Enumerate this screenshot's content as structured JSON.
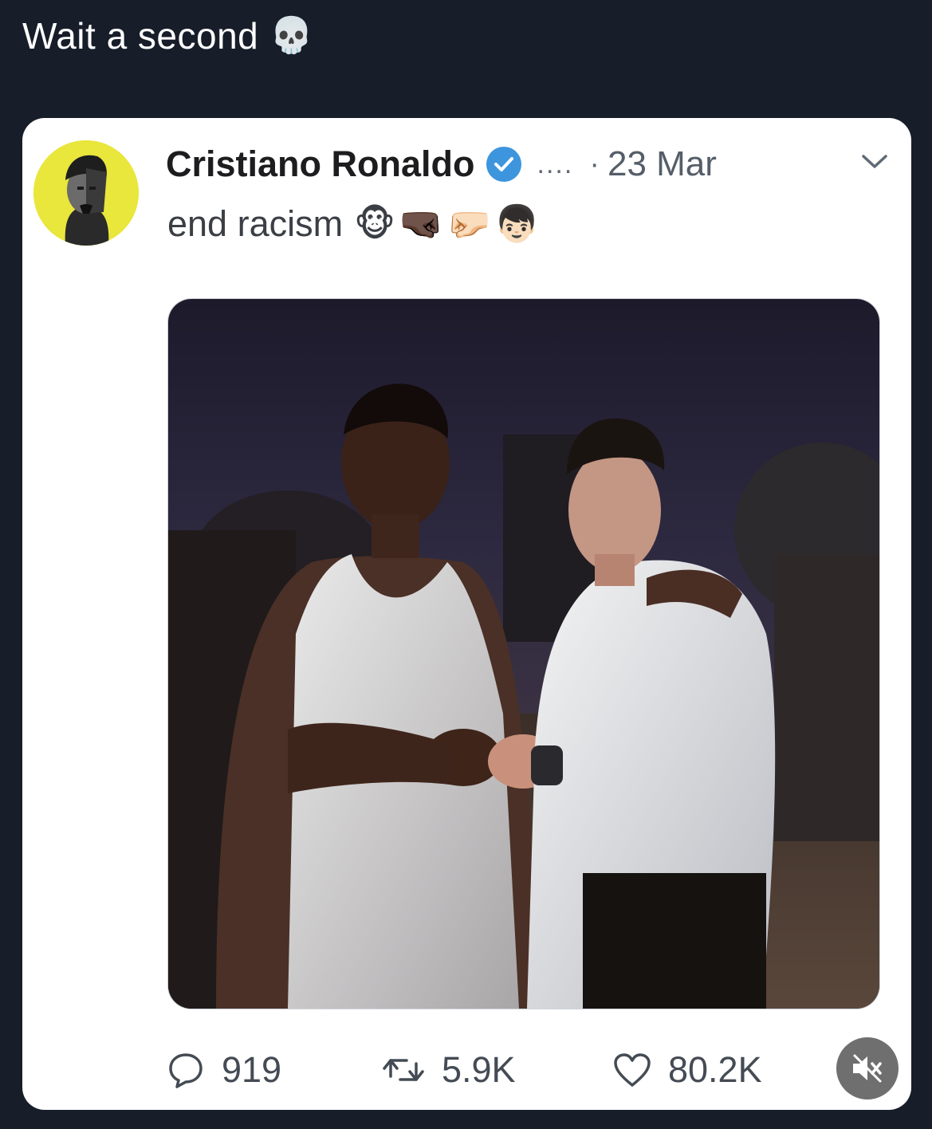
{
  "post": {
    "caption": "Wait a second",
    "caption_emoji": "💀"
  },
  "tweet": {
    "author_name": "Cristiano Ronaldo",
    "handle": "....",
    "separator": "·",
    "date": "23 Mar",
    "text": "end racism",
    "emojis": [
      "🐵",
      "🤜🏿",
      "🤛🏻",
      "👦🏻"
    ],
    "stats": {
      "replies": "919",
      "retweets": "5.9K",
      "likes": "80.2K"
    }
  },
  "colors": {
    "background": "#171d29",
    "card": "#ffffff",
    "verified": "#3d95dd",
    "avatar_bg": "#e9e63c",
    "mute_button": "#6f6f6f"
  },
  "icons": {
    "verified": "verified-badge-icon",
    "menu": "chevron-down-icon",
    "reply": "reply-bubble-icon",
    "retweet": "retweet-icon",
    "like": "heart-icon",
    "mute": "speaker-muted-icon"
  }
}
